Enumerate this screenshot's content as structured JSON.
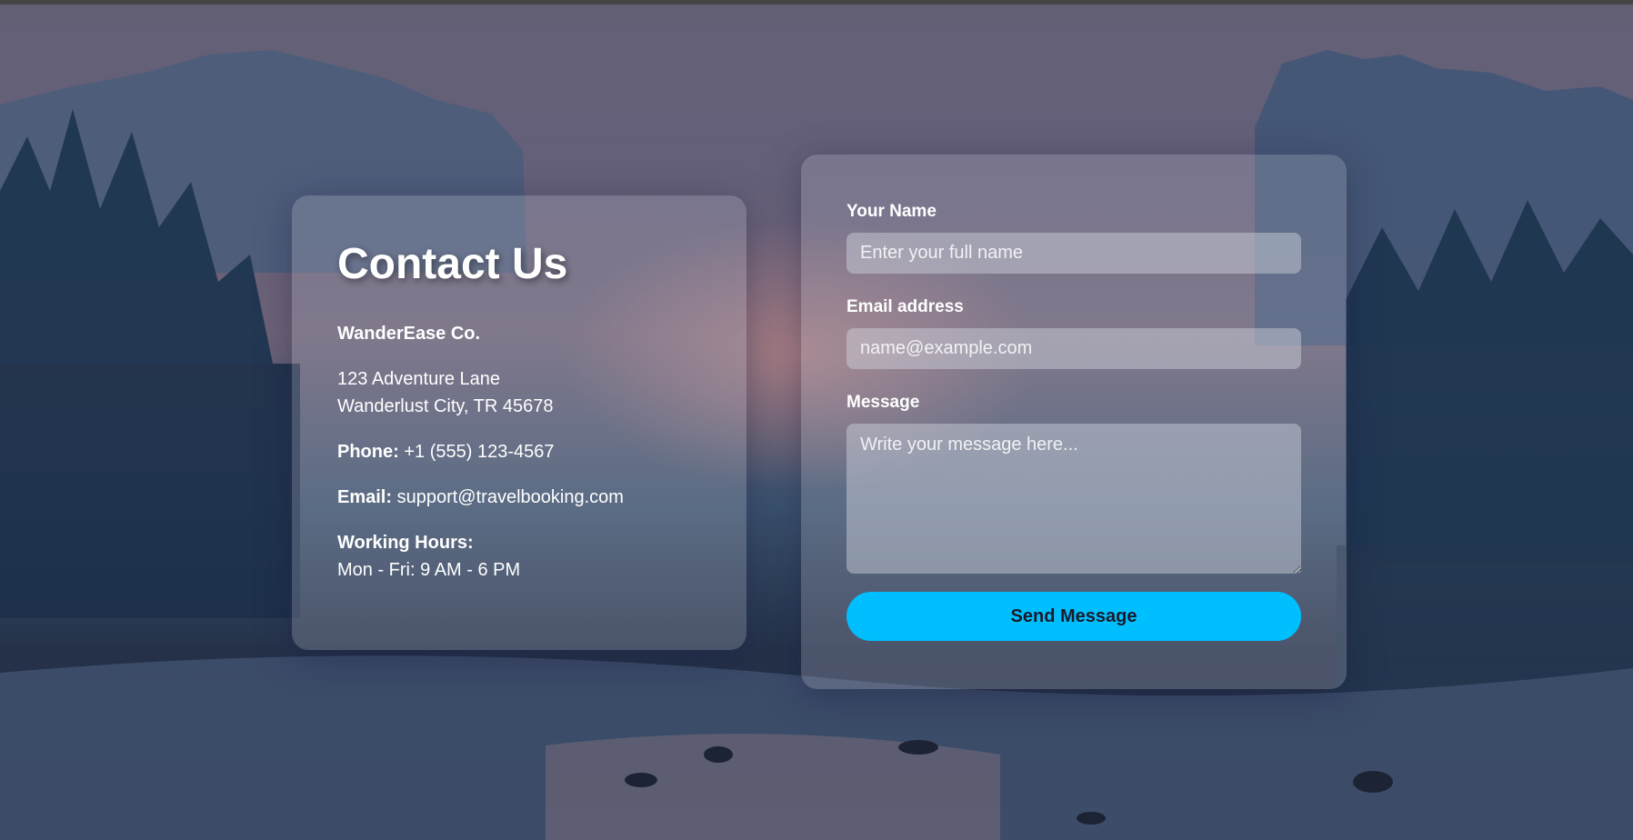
{
  "colors": {
    "accent": "#00bfff",
    "card_background": "rgba(175,175,195,0.28)"
  },
  "contact": {
    "title": "Contact Us",
    "company": "WanderEase Co.",
    "address_line1": "123 Adventure Lane",
    "address_line2": "Wanderlust City, TR 45678",
    "phone_label": "Phone:",
    "phone_value": "+1 (555) 123-4567",
    "email_label": "Email:",
    "email_value": "support@travelbooking.com",
    "hours_label": "Working Hours:",
    "hours_value": "Mon - Fri: 9 AM - 6 PM"
  },
  "form": {
    "name_label": "Your Name",
    "name_placeholder": "Enter your full name",
    "name_value": "",
    "email_label": "Email address",
    "email_placeholder": "name@example.com",
    "email_value": "",
    "message_label": "Message",
    "message_placeholder": "Write your message here...",
    "message_value": "",
    "submit_label": "Send Message"
  }
}
